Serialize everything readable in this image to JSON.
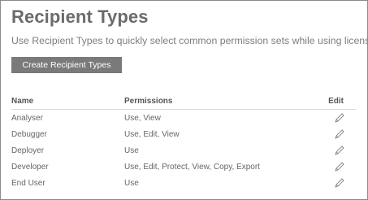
{
  "header": {
    "title": "Recipient Types",
    "subtitle": "Use Recipient Types to quickly select common permission sets while using licenses."
  },
  "actions": {
    "create_label": "Create Recipient Types"
  },
  "table": {
    "columns": {
      "name": "Name",
      "permissions": "Permissions",
      "edit": "Edit"
    },
    "rows": [
      {
        "name": "Analyser",
        "permissions": "Use, View",
        "edit_icon": "pencil-icon"
      },
      {
        "name": "Debugger",
        "permissions": "Use, Edit, View",
        "edit_icon": "pencil-icon"
      },
      {
        "name": "Deployer",
        "permissions": "Use",
        "edit_icon": "pencil-icon"
      },
      {
        "name": "Developer",
        "permissions": "Use, Edit, Protect, View, Copy, Export",
        "edit_icon": "pencil-icon"
      },
      {
        "name": "End User",
        "permissions": "Use",
        "edit_icon": "pencil-icon"
      }
    ]
  },
  "colors": {
    "title": "#6b6b6b",
    "button_bg": "#7a7a7a",
    "border": "#8a8a8a"
  }
}
